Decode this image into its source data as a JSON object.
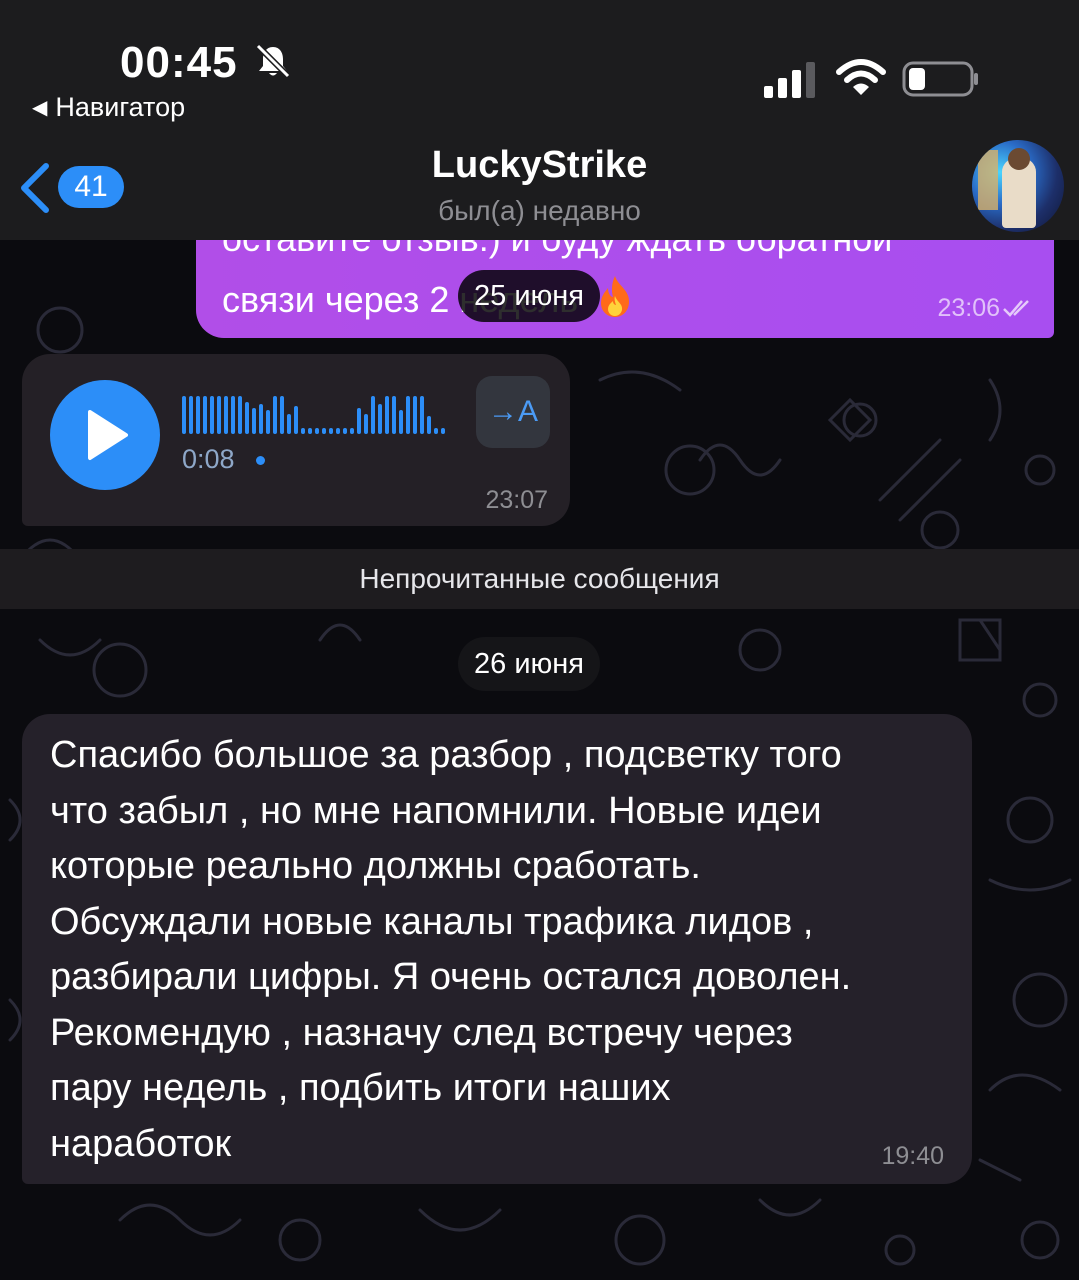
{
  "status_bar": {
    "time": "00:45",
    "back_app": "Навигатор",
    "icons": [
      "bell-muted-icon",
      "signal-icon",
      "wifi-icon",
      "battery-icon"
    ]
  },
  "header": {
    "back_icon": "chevron-left-icon",
    "unread_count": "41",
    "title": "LuckyStrike",
    "status": "был(а) недавно",
    "avatar": "contact-avatar"
  },
  "messages": {
    "outgoing_partial": {
      "line1": "оставите отзыв:) и буду ждать обратной",
      "line2_prefix": "связи через 2 недель",
      "emoji": "fire-emoji",
      "time": "23:06",
      "status_icon": "double-check-icon"
    },
    "date_1": "25 июня",
    "voice": {
      "duration": "0:08",
      "time": "23:07",
      "transcribe_label": "→A",
      "play_icon": "play-icon"
    },
    "unread_banner": "Непрочитанные сообщения",
    "date_2": "26 июня",
    "incoming_text": {
      "text": "Спасибо большое за разбор , подсветку того\nчто забыл , но мне напомнили. Новые идеи\nкоторые реально должны сработать.\nОбсуждали новые каналы трафика лидов ,\nразбирали цифры. Я очень остался доволен.\nРекомендую , назначу след встречу через\nпару недель , подбить итоги наших\nнаработок",
      "time": "19:40"
    }
  },
  "colors": {
    "accent": "#2c8ef8",
    "outgoing_bubble": "#a84ef0",
    "incoming_bubble": "#25212a",
    "header_bg": "#1c1c1e"
  }
}
